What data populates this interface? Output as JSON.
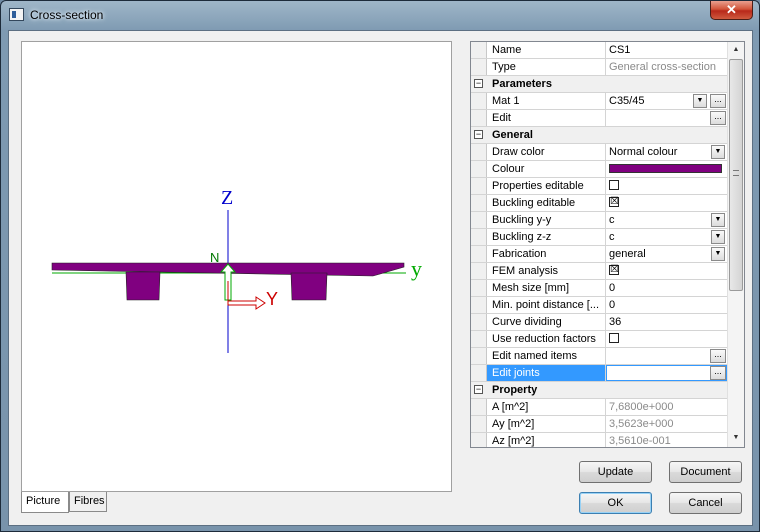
{
  "window": {
    "title": "Cross-section",
    "close_glyph": "✕"
  },
  "picture": {
    "axis_z": "Z",
    "axis_y": "y",
    "local_N": "N",
    "local_Y": "Y",
    "colors": {
      "section": "#800080",
      "axis_z": "#0000cc",
      "axis_y": "#00aa00",
      "local": "#cc0000"
    }
  },
  "tabs": [
    {
      "label": "Picture"
    },
    {
      "label": "Fibres"
    }
  ],
  "grid": {
    "rows": [
      {
        "name": "Name",
        "value": "CS1"
      },
      {
        "name": "Type",
        "value": "General cross-section"
      },
      {
        "name": "Parameters",
        "toggle": "−"
      },
      {
        "name": "Mat 1",
        "value": "C35/45"
      },
      {
        "name": "Edit",
        "value": ""
      },
      {
        "name": "General",
        "toggle": "−"
      },
      {
        "name": "Draw color",
        "value": "Normal colour"
      },
      {
        "name": "Colour",
        "value": ""
      },
      {
        "name": "Properties editable",
        "check": ""
      },
      {
        "name": "Buckling editable",
        "check": "☒"
      },
      {
        "name": "Buckling y-y",
        "value": "c"
      },
      {
        "name": "Buckling z-z",
        "value": "c"
      },
      {
        "name": "Fabrication",
        "value": "general"
      },
      {
        "name": "FEM analysis",
        "check": "☒"
      },
      {
        "name": "Mesh size [mm]",
        "value": "0"
      },
      {
        "name": "Min. point distance [...",
        "value": "0"
      },
      {
        "name": "Curve dividing",
        "value": "36"
      },
      {
        "name": "Use reduction factors",
        "check": ""
      },
      {
        "name": "Edit named items",
        "value": ""
      },
      {
        "name": "Edit joints",
        "value": ""
      },
      {
        "name": "Property",
        "toggle": "−"
      },
      {
        "name": "A [m^2]",
        "value": "7,6800e+000"
      },
      {
        "name": "Ay [m^2]",
        "value": "3,5623e+000"
      },
      {
        "name": "Az [m^2]",
        "value": "3,5610e-001"
      }
    ],
    "colour_swatch": "#800080",
    "ellipsis": "...",
    "dropdown_glyph": "▼",
    "scroll_up": "▲",
    "scroll_down": "▼"
  },
  "buttons": {
    "update": "Update",
    "document": "Document",
    "ok": "OK",
    "cancel": "Cancel"
  }
}
